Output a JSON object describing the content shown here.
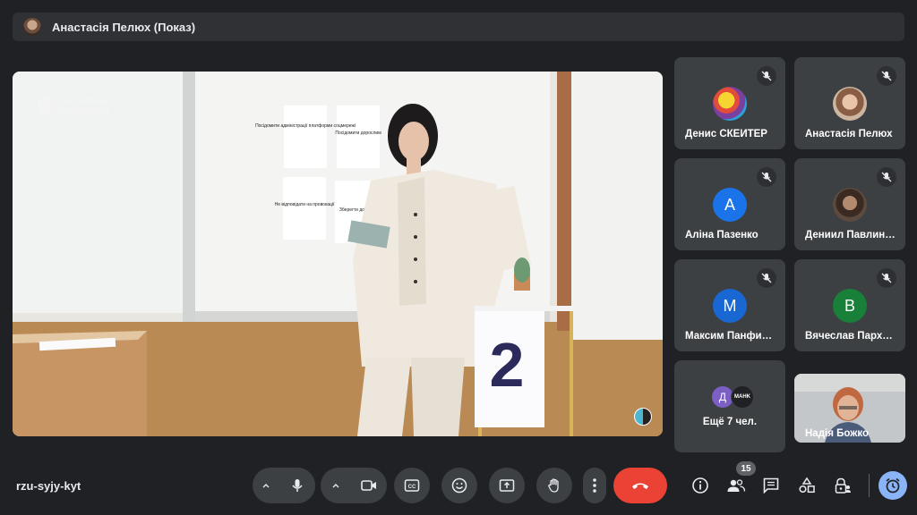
{
  "presentation": {
    "title": "Анастасія Пелюх (Показ)",
    "watermark_line1": "СУСПІЛЬНЕ",
    "watermark_line2": "МОВЛЕННЯ",
    "wall_cards": [
      "Посідомити адміністрації платформи соцмережі",
      "Посідомити дорослим",
      "Не відповідати на провокації",
      "Зберегти докази"
    ],
    "box_number": "2"
  },
  "participants": [
    {
      "name": "Денис СКЕЙТЕР",
      "avatar": "image"
    },
    {
      "name": "Анастасія Пелюх",
      "avatar": "image"
    },
    {
      "name": "Аліна Пазенко",
      "initial": "А",
      "color": "#1a73e8"
    },
    {
      "name": "Дениил Павлин…",
      "avatar": "image"
    },
    {
      "name": "Максим Панфи…",
      "initial": "М",
      "color": "#1967d2"
    },
    {
      "name": "Вячеслав Парх…",
      "initial": "В",
      "color": "#188038"
    }
  ],
  "more": {
    "label": "Ещё 7 чел.",
    "initial1": "Д",
    "initial2": "MAHK",
    "color1": "#7b5fc4",
    "color2": "#202124"
  },
  "self_view": {
    "name": "Надія Божко"
  },
  "meeting": {
    "code": "rzu-syjy-kyt",
    "participant_count": "15"
  },
  "colors": {
    "background": "#202124",
    "tile": "#3c4043",
    "end_call": "#ea4335",
    "accent": "#8ab4f8"
  }
}
